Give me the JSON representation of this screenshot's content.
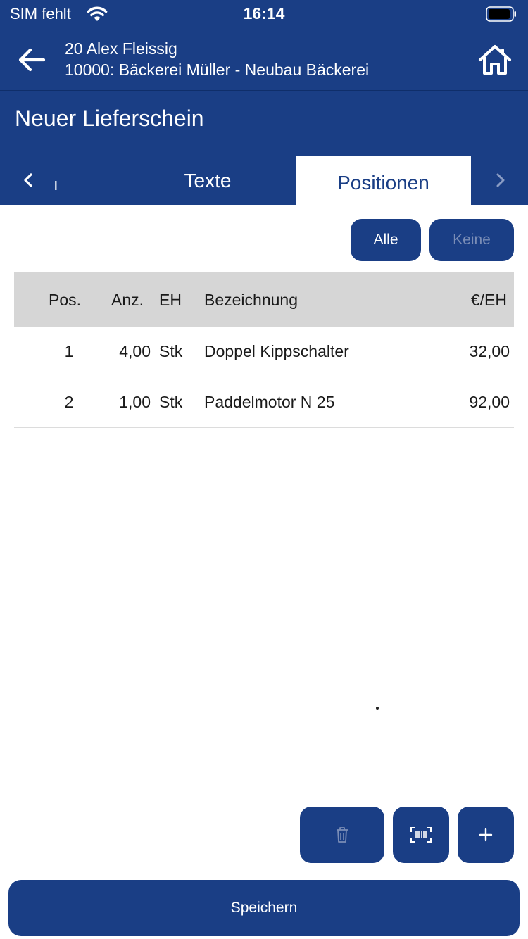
{
  "status_bar": {
    "carrier": "SIM fehlt",
    "time": "16:14"
  },
  "nav": {
    "line1": "20 Alex Fleissig",
    "line2": "10000: Bäckerei Müller - Neubau Bäckerei",
    "back_icon": "arrow-left-icon",
    "home_icon": "home-icon"
  },
  "page_title": "Neuer Lieferschein",
  "tabs": {
    "partial_label": "ı",
    "items": [
      {
        "label": "Texte",
        "active": false
      },
      {
        "label": "Positionen",
        "active": true
      }
    ]
  },
  "selection": {
    "all_label": "Alle",
    "none_label": "Keine"
  },
  "table": {
    "headers": {
      "pos": "Pos.",
      "anz": "Anz.",
      "eh": "EH",
      "bez": "Bezeichnung",
      "price": "€/EH"
    },
    "rows": [
      {
        "pos": "1",
        "anz": "4,00",
        "eh": "Stk",
        "bez": "Doppel Kippschalter",
        "price": "32,00"
      },
      {
        "pos": "2",
        "anz": "1,00",
        "eh": "Stk",
        "bez": "Paddelmotor N 25",
        "price": "92,00"
      }
    ]
  },
  "actions": {
    "delete_icon": "trash-icon",
    "scan_icon": "barcode-scan-icon",
    "add_label": "+"
  },
  "save_label": "Speichern",
  "colors": {
    "primary": "#1a3e85",
    "header_row": "#d6d6d6",
    "disabled_text": "#7a8db6"
  }
}
